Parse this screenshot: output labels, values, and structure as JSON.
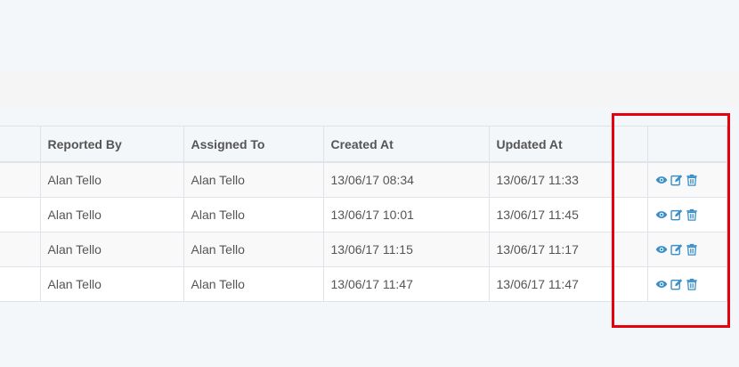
{
  "table": {
    "headers": {
      "reported_by": "Reported By",
      "assigned_to": "Assigned To",
      "created_at": "Created At",
      "updated_at": "Updated At"
    },
    "rows": [
      {
        "reported_by": "Alan Tello",
        "assigned_to": "Alan Tello",
        "created_at": "13/06/17 08:34",
        "updated_at": "13/06/17 11:33"
      },
      {
        "reported_by": "Alan Tello",
        "assigned_to": "Alan Tello",
        "created_at": "13/06/17 10:01",
        "updated_at": "13/06/17 11:45"
      },
      {
        "reported_by": "Alan Tello",
        "assigned_to": "Alan Tello",
        "created_at": "13/06/17 11:15",
        "updated_at": "13/06/17 11:17"
      },
      {
        "reported_by": "Alan Tello",
        "assigned_to": "Alan Tello",
        "created_at": "13/06/17 11:47",
        "updated_at": "13/06/17 11:47"
      }
    ],
    "row_actions": [
      "eye-icon",
      "edit-icon",
      "trash-icon"
    ]
  },
  "colors": {
    "action_icon": "#3a8fc9",
    "highlight_box": "#e8000b",
    "page_background": "#f3f7fa"
  }
}
